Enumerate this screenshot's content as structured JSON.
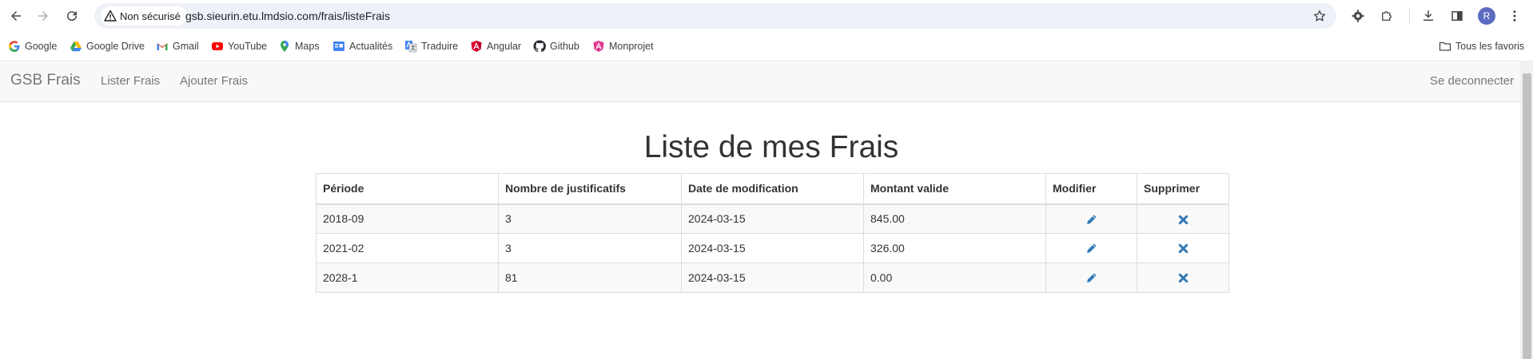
{
  "browser": {
    "security_label": "Non sécurisé",
    "url": "gsb.sieurin.etu.lmdsio.com/frais/listeFrais",
    "profile_initial": "R"
  },
  "bookmarks": {
    "items": [
      {
        "label": "Google",
        "icon": "google-icon"
      },
      {
        "label": "Google Drive",
        "icon": "google-drive-icon"
      },
      {
        "label": "Gmail",
        "icon": "gmail-icon"
      },
      {
        "label": "YouTube",
        "icon": "youtube-icon"
      },
      {
        "label": "Maps",
        "icon": "maps-icon"
      },
      {
        "label": "Actualités",
        "icon": "news-icon"
      },
      {
        "label": "Traduire",
        "icon": "translate-icon"
      },
      {
        "label": "Angular",
        "icon": "angular-icon"
      },
      {
        "label": "Github",
        "icon": "github-icon"
      },
      {
        "label": "Monprojet",
        "icon": "angular-icon"
      }
    ],
    "all_bookmarks": "Tous les favoris"
  },
  "navbar": {
    "brand": "GSB Frais",
    "links": [
      "Lister Frais",
      "Ajouter Frais"
    ],
    "logout": "Se deconnecter"
  },
  "main": {
    "title": "Liste de mes Frais",
    "table": {
      "headers": [
        "Période",
        "Nombre de justificatifs",
        "Date de modification",
        "Montant valide",
        "Modifier",
        "Supprimer"
      ],
      "rows": [
        {
          "periode": "2018-09",
          "justificatifs": "3",
          "date": "2024-03-15",
          "montant": "845.00"
        },
        {
          "periode": "2021-02",
          "justificatifs": "3",
          "date": "2024-03-15",
          "montant": "326.00"
        },
        {
          "periode": "2028-1",
          "justificatifs": "81",
          "date": "2024-03-15",
          "montant": "0.00"
        }
      ],
      "edit_icon": "pencil-icon",
      "delete_icon": "x-icon"
    }
  },
  "colors": {
    "action_icon": "#337ab7",
    "navbar_bg": "#f8f8f8",
    "navbar_text": "#777777",
    "omnibox_bg": "#eef1f8"
  }
}
